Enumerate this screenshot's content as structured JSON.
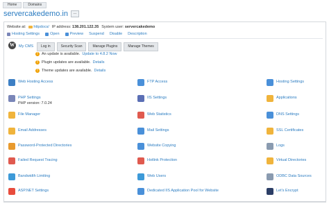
{
  "breadcrumb": [
    "Home",
    "Domains"
  ],
  "page_title": "servercakedemo.in",
  "more_button": "...",
  "info": {
    "website_at_label": "Website at:",
    "website_at_link": "httpdocs/",
    "ip_label": "IP address:",
    "ip_value": "138.201.122.35",
    "system_user_label": "System user:",
    "system_user_value": "servercakedemo"
  },
  "actions": [
    "Hosting Settings",
    "Open",
    "Preview",
    "Suspend",
    "Disable",
    "Description"
  ],
  "wordpress": {
    "label": "My CMS",
    "tabs": [
      "Log in",
      "Security Scan",
      "Manage Plugins",
      "Manage Themes"
    ],
    "notices": [
      {
        "text": "An update is available.",
        "link": "Update to 4.8.2 Now"
      },
      {
        "text": "Plugin updates are available.",
        "link": "Details"
      },
      {
        "text": "Theme updates are available.",
        "link": "Details"
      }
    ]
  },
  "tools": {
    "col1": [
      {
        "label": "Web Hosting Access",
        "icon": "globe-icon",
        "color": "#3d7fc4"
      },
      {
        "label": "PHP Settings",
        "sub": "PHP version: 7.0.24",
        "icon": "php-icon",
        "color": "#7a86b8"
      },
      {
        "label": "File Manager",
        "icon": "folder-icon",
        "color": "#f0b43c"
      },
      {
        "label": "Email Addresses",
        "icon": "email-icon",
        "color": "#f0b43c"
      },
      {
        "label": "Password-Protected Directories",
        "icon": "protected-folder-icon",
        "color": "#e89a2e"
      },
      {
        "label": "Failed Request Tracing",
        "icon": "tracing-icon",
        "color": "#e05a4f"
      },
      {
        "label": "Bandwidth Limiting",
        "icon": "bandwidth-icon",
        "color": "#3d9ad8"
      },
      {
        "label": "ASP.NET Settings",
        "icon": "windows-icon",
        "color": "#e84c3d"
      }
    ],
    "col2": [
      {
        "label": "FTP Access",
        "icon": "ftp-icon",
        "color": "#4a90d9"
      },
      {
        "label": "IIS Settings",
        "icon": "iis-icon",
        "color": "#5b6fb5"
      },
      {
        "label": "Web Statistics",
        "icon": "statistics-icon",
        "color": "#e05a4f"
      },
      {
        "label": "Mail Settings",
        "icon": "mail-settings-icon",
        "color": "#4a90d9"
      },
      {
        "label": "Website Copying",
        "icon": "copy-icon",
        "color": "#4a90d9"
      },
      {
        "label": "Hotlink Protection",
        "icon": "hotlink-icon",
        "color": "#e05a4f"
      },
      {
        "label": "Web Users",
        "icon": "web-users-icon",
        "color": "#3d9ad8"
      },
      {
        "label": "Dedicated IIS Application Pool for Website",
        "icon": "app-pool-icon",
        "color": "#4a90d9"
      }
    ],
    "col3": [
      {
        "label": "Hosting Settings",
        "icon": "hosting-settings-icon",
        "color": "#4a90d9"
      },
      {
        "label": "Applications",
        "icon": "applications-icon",
        "color": "#f0b43c"
      },
      {
        "label": "DNS Settings",
        "icon": "dns-icon",
        "color": "#4a90d9"
      },
      {
        "label": "SSL Certificates",
        "icon": "ssl-icon",
        "color": "#f0b43c"
      },
      {
        "label": "Logs",
        "icon": "logs-icon",
        "color": "#8a9bb0"
      },
      {
        "label": "Virtual Directories",
        "icon": "virtual-dir-icon",
        "color": "#f0b43c"
      },
      {
        "label": "ODBC Data Sources",
        "icon": "odbc-icon",
        "color": "#8a9bb0"
      },
      {
        "label": "Let's Encrypt",
        "icon": "lets-encrypt-icon",
        "color": "#2c3e66"
      }
    ]
  }
}
